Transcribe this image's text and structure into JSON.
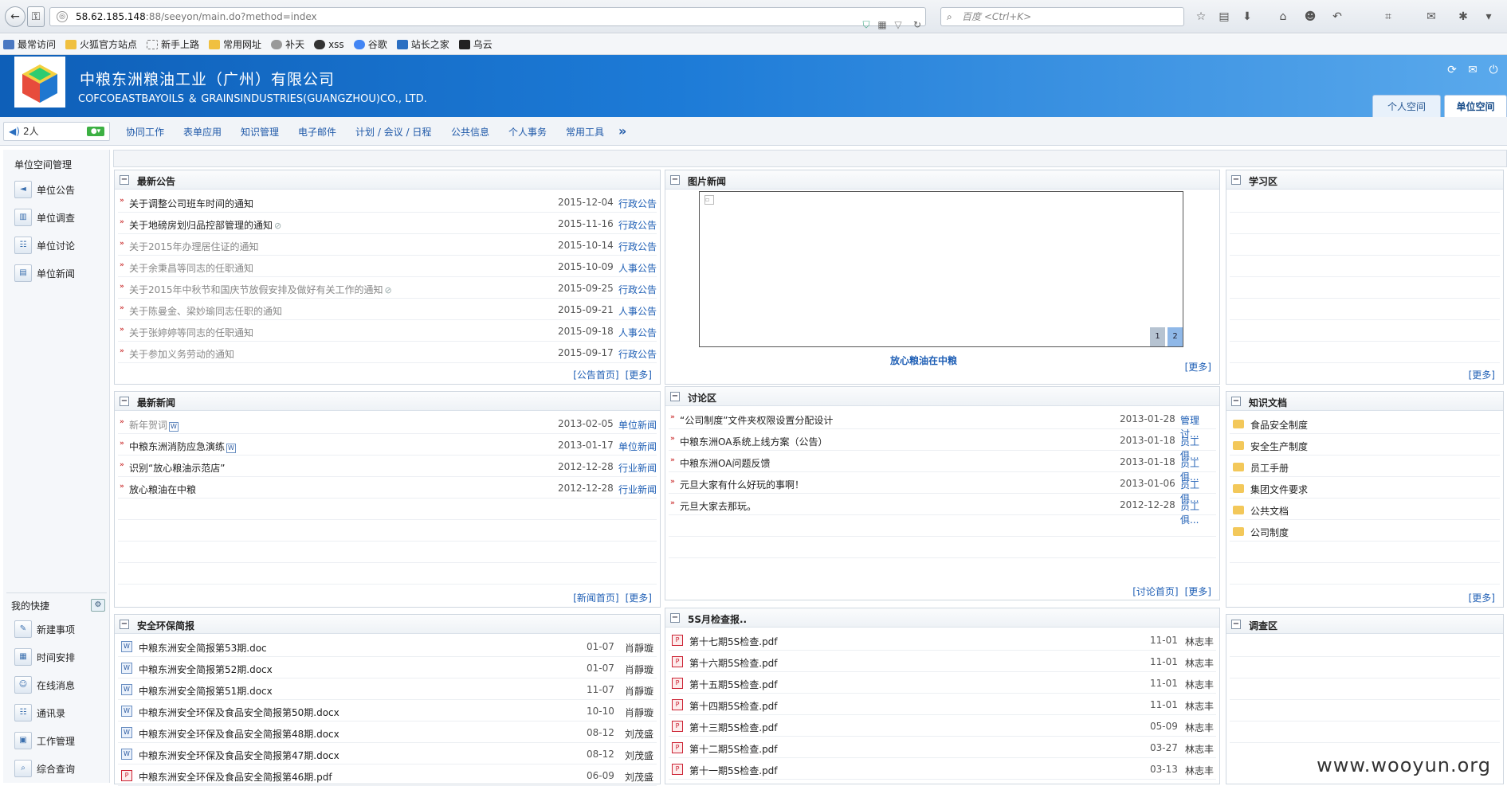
{
  "browser": {
    "url_host": "58.62.185.148",
    "url_rest": ":88/seeyon/main.do?method=index",
    "search_placeholder": "百度 <Ctrl+K>"
  },
  "bookmarks": [
    "最常访问",
    "火狐官方站点",
    "新手上路",
    "常用网址",
    "补天",
    "xss",
    "谷歌",
    "站长之家",
    "乌云"
  ],
  "header": {
    "company_cn": "中粮东洲粮油工业（广州）有限公司",
    "company_en": "COFCOEASTBAYOILS ＆ GRAINSINDUSTRIES(GUANGZHOU)CO., LTD.",
    "tab_personal": "个人空间",
    "tab_unit": "单位空间"
  },
  "menubar": {
    "online": "2人",
    "items": [
      "协同工作",
      "表单应用",
      "知识管理",
      "电子邮件",
      "计划 / 会议 / 日程",
      "公共信息",
      "个人事务",
      "常用工具"
    ],
    "more": "»"
  },
  "sidebar": {
    "title": "单位空间管理",
    "items": [
      "单位公告",
      "单位调查",
      "单位讨论",
      "单位新闻"
    ],
    "quick_title": "我的快捷",
    "quick_items": [
      "新建事项",
      "时间安排",
      "在线消息",
      "通讯录",
      "工作管理",
      "综合查询"
    ]
  },
  "announcements": {
    "title": "最新公告",
    "rows": [
      {
        "title": "关于调整公司班车时间的通知",
        "date": "2015-12-04",
        "cat": "行政公告"
      },
      {
        "title": "关于地磅房划归品控部管理的通知",
        "date": "2015-11-16",
        "cat": "行政公告"
      },
      {
        "title": "关于2015年办理居住证的通知",
        "date": "2015-10-14",
        "cat": "行政公告"
      },
      {
        "title": "关于余秉昌等同志的任职通知",
        "date": "2015-10-09",
        "cat": "人事公告"
      },
      {
        "title": "关于2015年中秋节和国庆节放假安排及做好有关工作的通知",
        "date": "2015-09-25",
        "cat": "行政公告"
      },
      {
        "title": "关于陈曼金、梁妙瑜同志任职的通知",
        "date": "2015-09-21",
        "cat": "人事公告"
      },
      {
        "title": "关于张婷婷等同志的任职通知",
        "date": "2015-09-18",
        "cat": "人事公告"
      },
      {
        "title": "关于参加义务劳动的通知",
        "date": "2015-09-17",
        "cat": "行政公告"
      }
    ],
    "foot_home": "[公告首页]",
    "foot_more": "[更多]"
  },
  "picnews": {
    "title": "图片新闻",
    "caption": "放心粮油在中粮",
    "pages": [
      "1",
      "2"
    ],
    "foot_more": "[更多]"
  },
  "study": {
    "title": "学习区",
    "foot_more": "[更多]"
  },
  "news": {
    "title": "最新新闻",
    "rows": [
      {
        "title": "新年贺词",
        "date": "2013-02-05",
        "cat": "单位新闻"
      },
      {
        "title": "中粮东洲消防应急演练",
        "date": "2013-01-17",
        "cat": "单位新闻"
      },
      {
        "title": "识别“放心粮油示范店”",
        "date": "2012-12-28",
        "cat": "行业新闻"
      },
      {
        "title": "放心粮油在中粮",
        "date": "2012-12-28",
        "cat": "行业新闻"
      }
    ],
    "foot_home": "[新闻首页]",
    "foot_more": "[更多]"
  },
  "discussion": {
    "title": "讨论区",
    "rows": [
      {
        "title": "“公司制度”文件夹权限设置分配设计",
        "date": "2013-01-28",
        "cat": "管理讨..."
      },
      {
        "title": "中粮东洲OA系统上线方案（公告）",
        "date": "2013-01-18",
        "cat": "员工俱..."
      },
      {
        "title": "中粮东洲OA问题反馈",
        "date": "2013-01-18",
        "cat": "员工俱..."
      },
      {
        "title": "元旦大家有什么好玩的事啊！",
        "date": "2013-01-06",
        "cat": "员工俱..."
      },
      {
        "title": "元旦大家去那玩。",
        "date": "2012-12-28",
        "cat": "员工俱..."
      }
    ],
    "foot_home": "[讨论首页]",
    "foot_more": "[更多]"
  },
  "knowledge": {
    "title": "知识文档",
    "rows": [
      "食品安全制度",
      "安全生产制度",
      "员工手册",
      "集团文件要求",
      "公共文档",
      "公司制度"
    ],
    "foot_more": "[更多]"
  },
  "safety": {
    "title": "安全环保简报",
    "rows": [
      {
        "title": "中粮东洲安全简报第53期.doc",
        "date": "01-07",
        "author": "肖靜璇",
        "type": "doc"
      },
      {
        "title": "中粮东洲安全简报第52期.docx",
        "date": "01-07",
        "author": "肖靜璇",
        "type": "doc"
      },
      {
        "title": "中粮东洲安全简报第51期.docx",
        "date": "11-07",
        "author": "肖靜璇",
        "type": "doc"
      },
      {
        "title": "中粮东洲安全环保及食品安全简报第50期.docx",
        "date": "10-10",
        "author": "肖靜璇",
        "type": "doc"
      },
      {
        "title": "中粮东洲安全环保及食品安全简报第48期.docx",
        "date": "08-12",
        "author": "刘茂盛",
        "type": "doc"
      },
      {
        "title": "中粮东洲安全环保及食品安全简报第47期.docx",
        "date": "08-12",
        "author": "刘茂盛",
        "type": "doc"
      },
      {
        "title": "中粮东洲安全环保及食品安全简报第46期.pdf",
        "date": "06-09",
        "author": "刘茂盛",
        "type": "pdf"
      }
    ]
  },
  "fives": {
    "title": "5S月检查报..",
    "rows": [
      {
        "title": "第十七期5S检查.pdf",
        "date": "11-01",
        "author": "林志丰"
      },
      {
        "title": "第十六期5S检查.pdf",
        "date": "11-01",
        "author": "林志丰"
      },
      {
        "title": "第十五期5S检查.pdf",
        "date": "11-01",
        "author": "林志丰"
      },
      {
        "title": "第十四期5S检查.pdf",
        "date": "11-01",
        "author": "林志丰"
      },
      {
        "title": "第十三期5S检查.pdf",
        "date": "05-09",
        "author": "林志丰"
      },
      {
        "title": "第十二期5S检查.pdf",
        "date": "03-27",
        "author": "林志丰"
      },
      {
        "title": "第十一期5S检查.pdf",
        "date": "03-13",
        "author": "林志丰"
      }
    ]
  },
  "survey": {
    "title": "调查区"
  },
  "watermark": "www.wooyun.org"
}
